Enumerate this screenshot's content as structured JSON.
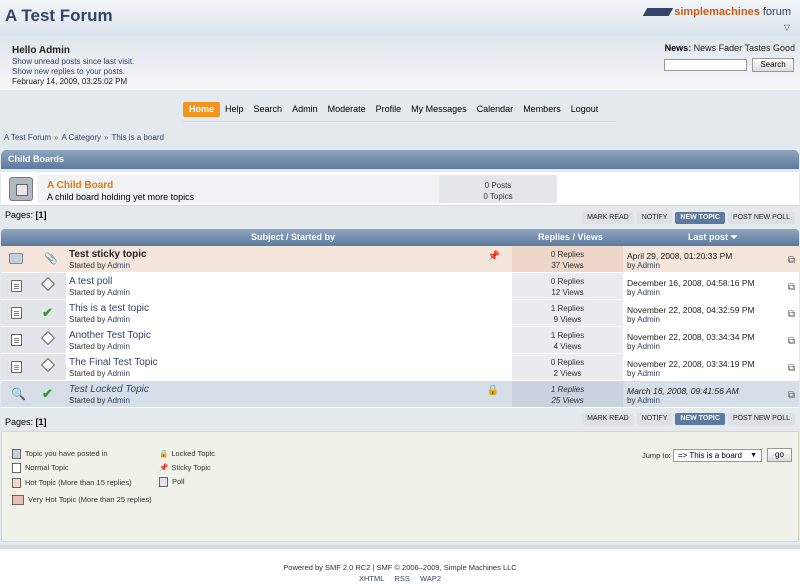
{
  "header": {
    "forum_title": "A Test Forum",
    "logo_simple": "simple",
    "logo_machines": "machines",
    "logo_forum": "forum"
  },
  "user": {
    "greeting": "Hello Admin",
    "link_unread": "Show unread posts since last visit.",
    "link_replies": "Show new replies to your posts.",
    "date": "February 14, 2009, 03:25:02 PM"
  },
  "news": {
    "label": "News:",
    "text": "News Fader Tastes Good"
  },
  "search": {
    "placeholder": "",
    "button": "Search"
  },
  "menu": [
    "Home",
    "Help",
    "Search",
    "Admin",
    "Moderate",
    "Profile",
    "My Messages",
    "Calendar",
    "Members",
    "Logout"
  ],
  "breadcrumb": [
    "A Test Forum",
    "A Category",
    "This is a board"
  ],
  "child_boards": {
    "header": "Child Boards",
    "board": {
      "name": "A Child Board",
      "description": "A child board holding yet more topics",
      "posts": "0 Posts",
      "topics": "0 Topics"
    }
  },
  "pages": {
    "label": "Pages:",
    "current": "[1]"
  },
  "buttons": [
    "MARK READ",
    "NOTIFY",
    "NEW TOPIC",
    "POST NEW POLL"
  ],
  "table": {
    "col_subject": "Subject / Started by",
    "col_replies": "Replies / Views",
    "col_last": "Last post",
    "started_by_label": "Started by",
    "by_label": "by",
    "rows": [
      {
        "subject": "Test sticky topic",
        "starter": "Admin",
        "replies": "0 Replies",
        "views": "37 Views",
        "last_date": "April 29, 2008, 01:20:33 PM",
        "last_by": "Admin"
      },
      {
        "subject": "A test poll",
        "starter": "Admin",
        "replies": "0 Replies",
        "views": "12 Views",
        "last_date": "December 16, 2008, 04:58:16 PM",
        "last_by": "Admin"
      },
      {
        "subject": "This is a test topic",
        "starter": "Admin",
        "replies": "1 Replies",
        "views": "9 Views",
        "last_date": "November 22, 2008, 04:32:59 PM",
        "last_by": "Admin"
      },
      {
        "subject": "Another Test Topic",
        "starter": "Admin",
        "replies": "1 Replies",
        "views": "4 Views",
        "last_date": "November 22, 2008, 03:34:34 PM",
        "last_by": "Admin"
      },
      {
        "subject": "The Final Test Topic",
        "starter": "Admin",
        "replies": "0 Replies",
        "views": "2 Views",
        "last_date": "November 22, 2008, 03:34:19 PM",
        "last_by": "Admin"
      },
      {
        "subject": "Test Locked Topic",
        "starter": "Admin",
        "replies": "1 Replies",
        "views": "25 Views",
        "last_date": "March 16, 2008, 09:41:56 AM",
        "last_by": "Admin"
      }
    ]
  },
  "legend": {
    "posted": "Topic you have posted in",
    "normal": "Normal Topic",
    "hot": "Hot Topic (More than 15 replies)",
    "very_hot": "Very Hot Topic (More than 25 replies)",
    "locked": "Locked Topic",
    "sticky": "Sticky Topic",
    "poll": "Poll"
  },
  "jump": {
    "label": "Jump to:",
    "selected": "=> This is a board",
    "go": "go"
  },
  "footer": {
    "line1": "Powered by SMF 2.0 RC2 | SMF © 2006–2009, Simple Machines LLC",
    "links": [
      "XHTML",
      "RSS",
      "WAP2"
    ]
  }
}
